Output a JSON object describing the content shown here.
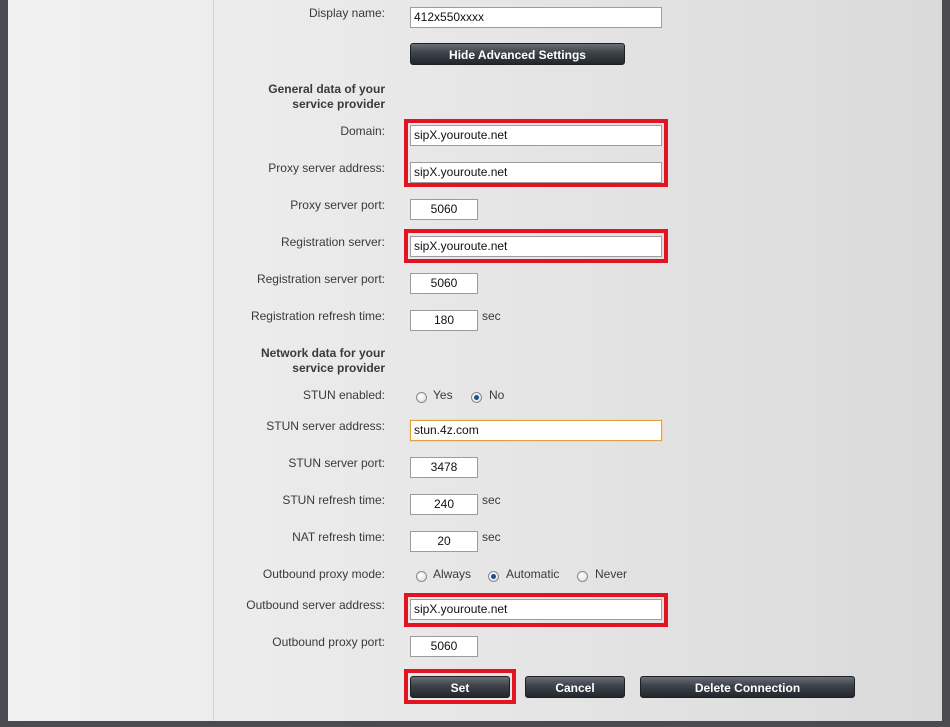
{
  "advanced_button": "Hide Advanced Settings",
  "display_name": {
    "label": "Display name:",
    "value": "412x550xxxx"
  },
  "section_general": {
    "line1": "General data of your",
    "line2": "service provider"
  },
  "domain": {
    "label": "Domain:",
    "value": "sipX.youroute.net"
  },
  "proxy_address": {
    "label": "Proxy server address:",
    "value": "sipX.youroute.net"
  },
  "proxy_port": {
    "label": "Proxy server port:",
    "value": "5060"
  },
  "registration_server": {
    "label": "Registration server:",
    "value": "sipX.youroute.net"
  },
  "registration_port": {
    "label": "Registration server port:",
    "value": "5060"
  },
  "registration_refresh": {
    "label": "Registration refresh time:",
    "value": "180",
    "unit": "sec"
  },
  "section_network": {
    "line1": "Network data for your",
    "line2": "service provider"
  },
  "stun_enabled": {
    "label": "STUN enabled:",
    "options": [
      "Yes",
      "No"
    ],
    "selected": "No"
  },
  "stun_address": {
    "label": "STUN server address:",
    "value": "stun.4z.com"
  },
  "stun_port": {
    "label": "STUN server port:",
    "value": "3478"
  },
  "stun_refresh": {
    "label": "STUN refresh time:",
    "value": "240",
    "unit": "sec"
  },
  "nat_refresh": {
    "label": "NAT refresh time:",
    "value": "20",
    "unit": "sec"
  },
  "outbound_mode": {
    "label": "Outbound proxy mode:",
    "options": [
      "Always",
      "Automatic",
      "Never"
    ],
    "selected": "Automatic"
  },
  "outbound_address": {
    "label": "Outbound server address:",
    "value": "sipX.youroute.net"
  },
  "outbound_port": {
    "label": "Outbound proxy port:",
    "value": "5060"
  },
  "buttons": {
    "set": "Set",
    "cancel": "Cancel",
    "delete": "Delete Connection"
  },
  "colors": {
    "highlight": "#e2141f",
    "button": "#2f343a",
    "focus_border": "#e0a23c"
  }
}
